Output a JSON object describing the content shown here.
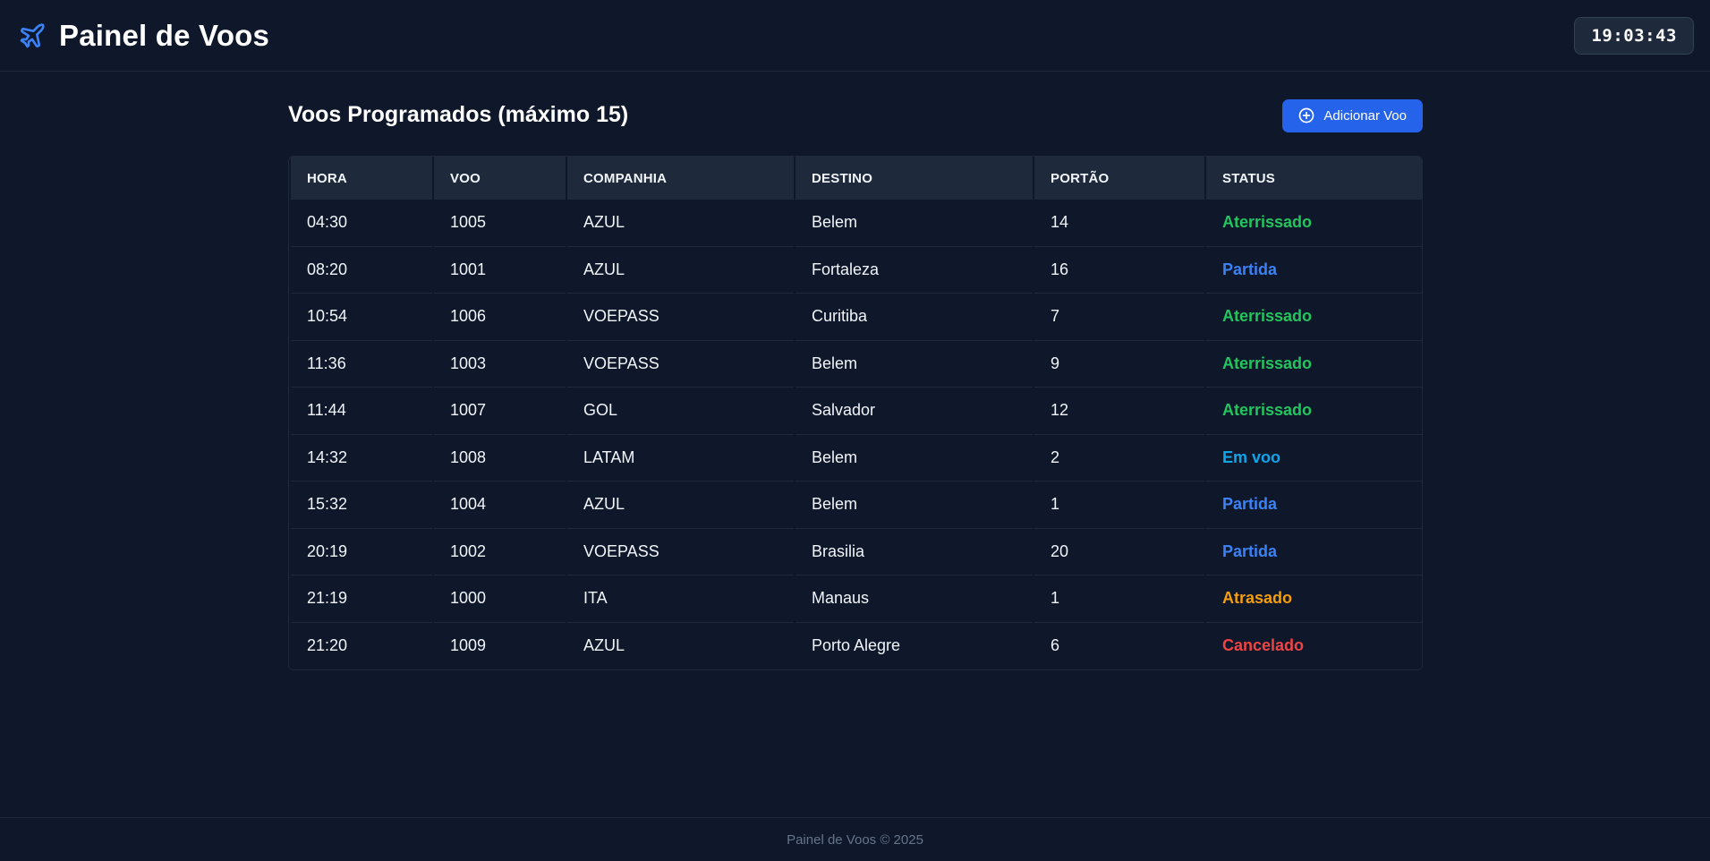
{
  "header": {
    "title": "Painel de Voos",
    "clock": "19:03:43",
    "icon": "airplane-icon"
  },
  "main": {
    "section_title": "Voos Programados (máximo 15)",
    "add_button_label": "Adicionar Voo"
  },
  "table": {
    "columns": [
      "HORA",
      "VOO",
      "COMPANHIA",
      "DESTINO",
      "PORTÃO",
      "STATUS"
    ],
    "rows": [
      {
        "hora": "04:30",
        "voo": "1005",
        "companhia": "AZUL",
        "destino": "Belem",
        "portao": "14",
        "status": "Aterrissado"
      },
      {
        "hora": "08:20",
        "voo": "1001",
        "companhia": "AZUL",
        "destino": "Fortaleza",
        "portao": "16",
        "status": "Partida"
      },
      {
        "hora": "10:54",
        "voo": "1006",
        "companhia": "VOEPASS",
        "destino": "Curitiba",
        "portao": "7",
        "status": "Aterrissado"
      },
      {
        "hora": "11:36",
        "voo": "1003",
        "companhia": "VOEPASS",
        "destino": "Belem",
        "portao": "9",
        "status": "Aterrissado"
      },
      {
        "hora": "11:44",
        "voo": "1007",
        "companhia": "GOL",
        "destino": "Salvador",
        "portao": "12",
        "status": "Aterrissado"
      },
      {
        "hora": "14:32",
        "voo": "1008",
        "companhia": "LATAM",
        "destino": "Belem",
        "portao": "2",
        "status": "Em voo"
      },
      {
        "hora": "15:32",
        "voo": "1004",
        "companhia": "AZUL",
        "destino": "Belem",
        "portao": "1",
        "status": "Partida"
      },
      {
        "hora": "20:19",
        "voo": "1002",
        "companhia": "VOEPASS",
        "destino": "Brasilia",
        "portao": "20",
        "status": "Partida"
      },
      {
        "hora": "21:19",
        "voo": "1000",
        "companhia": "ITA",
        "destino": "Manaus",
        "portao": "1",
        "status": "Atrasado"
      },
      {
        "hora": "21:20",
        "voo": "1009",
        "companhia": "AZUL",
        "destino": "Porto Alegre",
        "portao": "6",
        "status": "Cancelado"
      }
    ]
  },
  "status_colors": {
    "Aterrissado": "#22c55e",
    "Partida": "#3b82f6",
    "Em voo": "#0ea5e9",
    "Atrasado": "#f59e0b",
    "Cancelado": "#ef4444"
  },
  "colors": {
    "background": "#0f172a",
    "accent": "#2563eb"
  },
  "footer": {
    "text": "Painel de Voos © 2025"
  }
}
